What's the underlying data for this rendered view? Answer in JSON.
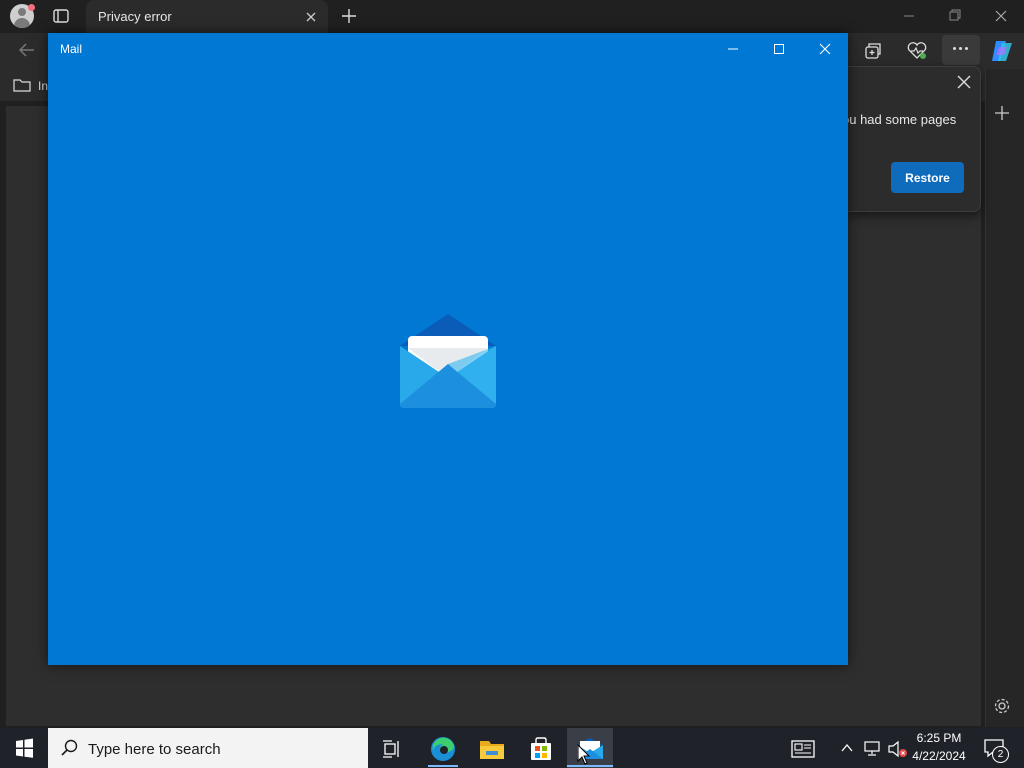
{
  "browser": {
    "tab_title": "Privacy error",
    "favorites_label": "In"
  },
  "restore_popup": {
    "message": "ou had some pages",
    "restore_label": "Restore"
  },
  "mail_window": {
    "title": "Mail",
    "icon": "mail-envelope-icon",
    "background": "#0078d4"
  },
  "taskbar": {
    "search_placeholder": "Type here to search",
    "pinned": [
      "task-view-icon",
      "edge-icon",
      "file-explorer-icon",
      "microsoft-store-icon",
      "mail-icon"
    ],
    "active_app": "Mail",
    "clock_time": "6:25 PM",
    "clock_date": "4/22/2024",
    "notification_count": "2"
  },
  "colors": {
    "accent": "#0078d4",
    "restore_button": "#0f6cbd",
    "taskbar": "#1f2229"
  }
}
